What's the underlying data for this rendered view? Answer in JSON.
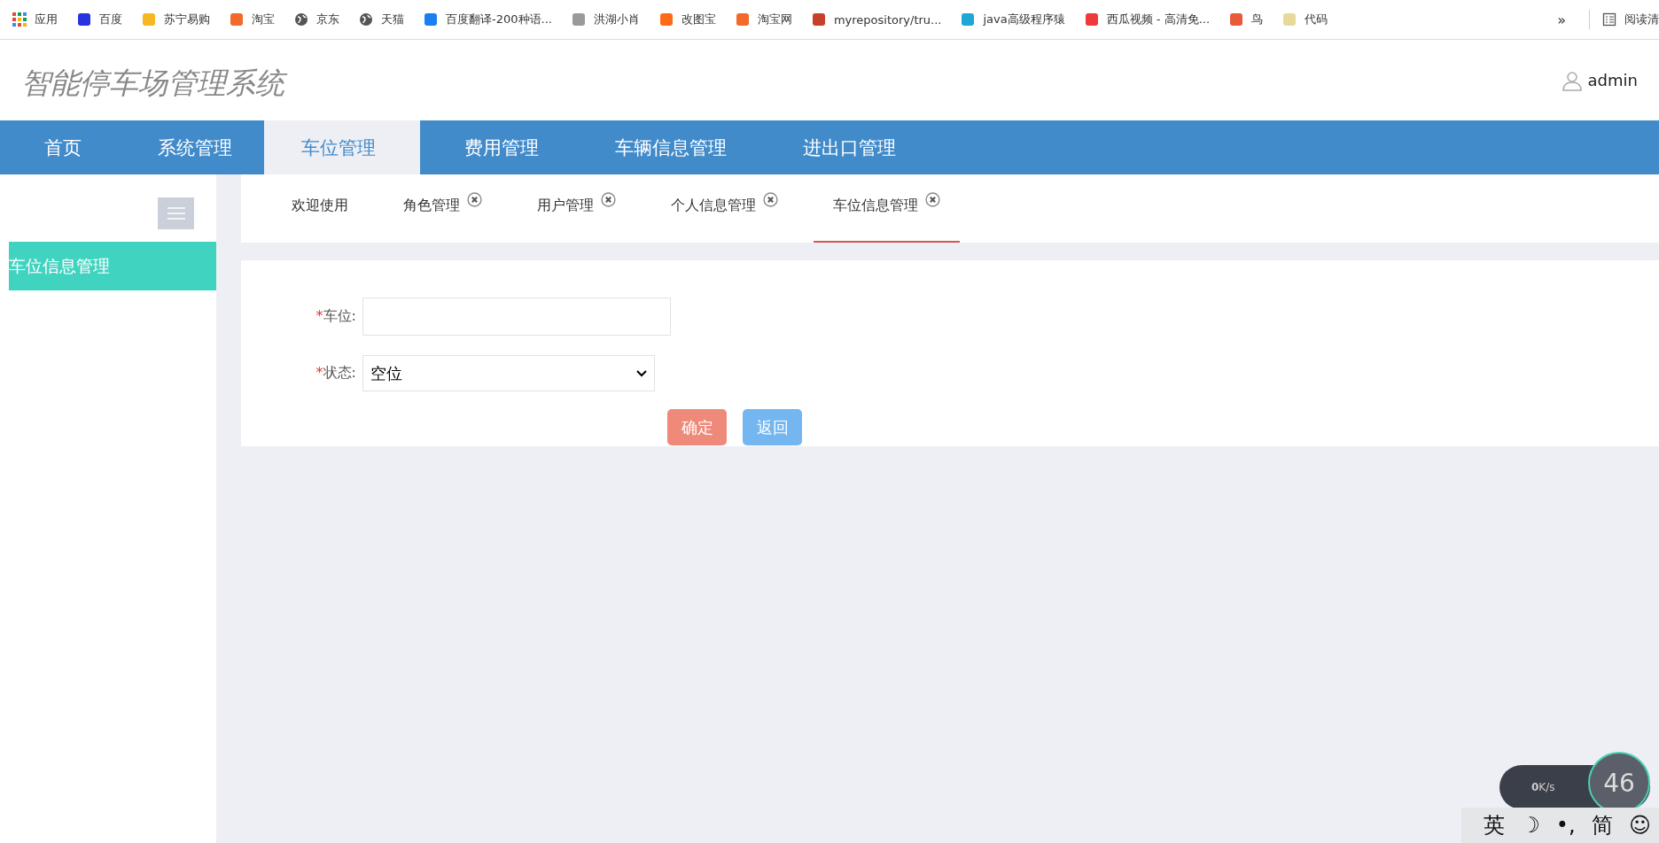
{
  "bookmarks": [
    {
      "label": "应用",
      "kind": "apps",
      "color": "#e04a3f"
    },
    {
      "label": "百度",
      "kind": "site",
      "color": "#2932e1"
    },
    {
      "label": "苏宁易购",
      "kind": "site",
      "color": "#f5b821"
    },
    {
      "label": "淘宝",
      "kind": "site",
      "color": "#f26a2a"
    },
    {
      "label": "京东",
      "kind": "globe",
      "color": "#555555"
    },
    {
      "label": "天猫",
      "kind": "globe",
      "color": "#555555"
    },
    {
      "label": "百度翻译-200种语...",
      "kind": "site",
      "color": "#1a7ff0"
    },
    {
      "label": "洪湖小肖",
      "kind": "site",
      "color": "#9a9a9a"
    },
    {
      "label": "改图宝",
      "kind": "site",
      "color": "#ff6a1a"
    },
    {
      "label": "淘宝网",
      "kind": "site",
      "color": "#f26a2a"
    },
    {
      "label": "myrepository/tru...",
      "kind": "site",
      "color": "#c8402a"
    },
    {
      "label": "java高级程序猿",
      "kind": "site",
      "color": "#1ea7d6"
    },
    {
      "label": "西瓜视频 - 高清免...",
      "kind": "site",
      "color": "#f03a3a"
    },
    {
      "label": "鸟",
      "kind": "site",
      "color": "#e85a3a"
    },
    {
      "label": "代码",
      "kind": "site",
      "color": "#e8d89a"
    }
  ],
  "bookmarks_more": "»",
  "reading_list": "阅读清",
  "app_title": "智能停车场管理系统",
  "user": "admin",
  "nav": [
    {
      "label": "首页",
      "selected": false
    },
    {
      "label": "系统管理",
      "selected": false
    },
    {
      "label": "车位管理",
      "selected": true
    },
    {
      "label": "费用管理",
      "selected": false
    },
    {
      "label": "车辆信息管理",
      "selected": false
    },
    {
      "label": "进出口管理",
      "selected": false
    }
  ],
  "sidebar": {
    "items": [
      {
        "label": "车位信息管理",
        "selected": true
      }
    ]
  },
  "tabs": [
    {
      "label": "欢迎使用",
      "closable": false,
      "selected": false
    },
    {
      "label": "角色管理",
      "closable": true,
      "selected": false
    },
    {
      "label": "用户管理",
      "closable": true,
      "selected": false
    },
    {
      "label": "个人信息管理",
      "closable": true,
      "selected": false
    },
    {
      "label": "车位信息管理",
      "closable": true,
      "selected": true
    }
  ],
  "form": {
    "fields": [
      {
        "mark": "*",
        "label": "车位:",
        "kind": "text"
      },
      {
        "mark": "*",
        "label": "状态:",
        "kind": "select",
        "value": "空位"
      }
    ],
    "buttons": [
      {
        "label": "确定",
        "kind": "primary"
      },
      {
        "label": "返回",
        "kind": "secondary"
      }
    ]
  },
  "widget": {
    "speed": "0",
    "speed_unit": "K/s",
    "percent": "46"
  },
  "ime": [
    "英",
    "☽",
    "•,",
    "简",
    "☺"
  ]
}
